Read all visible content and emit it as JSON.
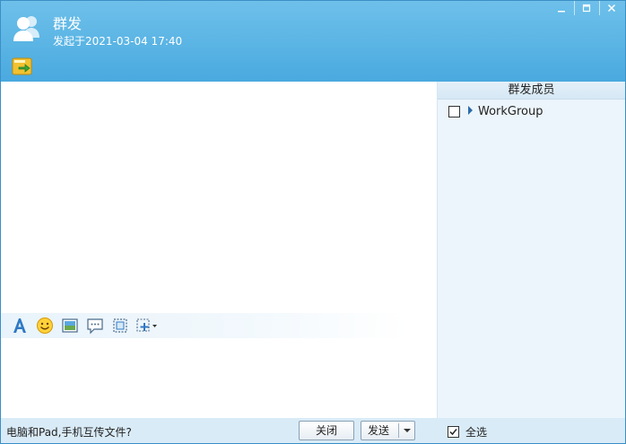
{
  "header": {
    "title": "群发",
    "subtitle": "发起于2021-03-04 17:40",
    "icons": [
      "group-avatar-icon",
      "send-file-icon"
    ],
    "window_controls": [
      "minimize-icon",
      "maximize-icon",
      "close-icon"
    ]
  },
  "toolbar": {
    "icons": [
      "font-icon",
      "emoji-icon",
      "image-icon",
      "bubble-icon",
      "screenshot-icon",
      "more-icon"
    ]
  },
  "members": {
    "title": "群发成员",
    "items": [
      {
        "label": "WorkGroup",
        "checked": false
      }
    ]
  },
  "footer": {
    "transfer_text": "电脑和Pad,手机互传文件?",
    "close_label": "关闭",
    "send_label": "发送",
    "select_all_label": "全选",
    "select_all_checked": true
  },
  "colors": {
    "header": "#5ab4e4",
    "panel": "#ecf5fb",
    "bottom_bar": "#d9ebf7"
  }
}
